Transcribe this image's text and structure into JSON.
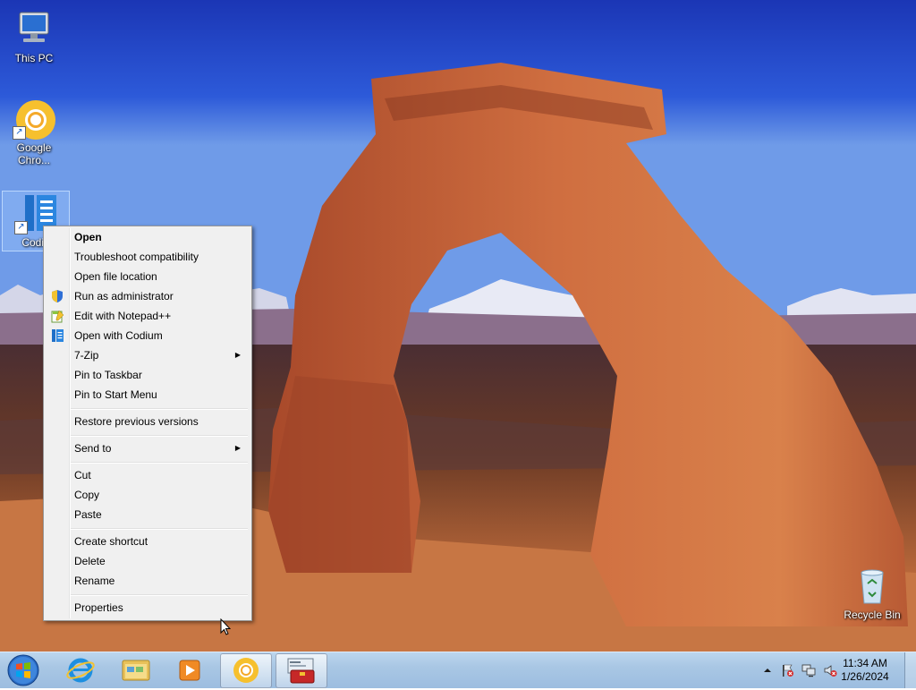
{
  "desktop": {
    "icons": [
      {
        "label": "This PC",
        "icon": "computer-icon"
      },
      {
        "label": "Google Chro...",
        "icon": "chrome-icon"
      },
      {
        "label": "Codiu",
        "icon": "codium-icon"
      },
      {
        "label": "Recycle Bin",
        "icon": "recycle-bin-icon"
      }
    ]
  },
  "context_menu": {
    "items": [
      {
        "label": "Open"
      },
      {
        "label": "Troubleshoot compatibility"
      },
      {
        "label": "Open file location"
      },
      {
        "label": "Run as administrator",
        "icon": "shield-icon"
      },
      {
        "label": "Edit with Notepad++",
        "icon": "notepad-plus-plus-icon"
      },
      {
        "label": "Open with Codium",
        "icon": "codium-icon"
      },
      {
        "label": "7-Zip"
      },
      {
        "label": "Pin to Taskbar"
      },
      {
        "label": "Pin to Start Menu"
      },
      {
        "label": "Restore previous versions"
      },
      {
        "label": "Send to"
      },
      {
        "label": "Cut"
      },
      {
        "label": "Copy"
      },
      {
        "label": "Paste"
      },
      {
        "label": "Create shortcut"
      },
      {
        "label": "Delete"
      },
      {
        "label": "Rename"
      },
      {
        "label": "Properties"
      }
    ]
  },
  "taskbar": {
    "start_icon": "windows-logo-icon",
    "pinned": [
      {
        "icon": "internet-explorer-icon"
      },
      {
        "icon": "file-explorer-icon"
      },
      {
        "icon": "media-player-icon"
      },
      {
        "icon": "chrome-icon"
      },
      {
        "icon": "toolbox-app-icon"
      }
    ],
    "tray": {
      "icons": [
        "show-hidden-icons-chevron",
        "action-center-flag-icon",
        "network-icon",
        "volume-muted-icon"
      ],
      "time": "11:34 AM",
      "date": "1/26/2024"
    }
  }
}
